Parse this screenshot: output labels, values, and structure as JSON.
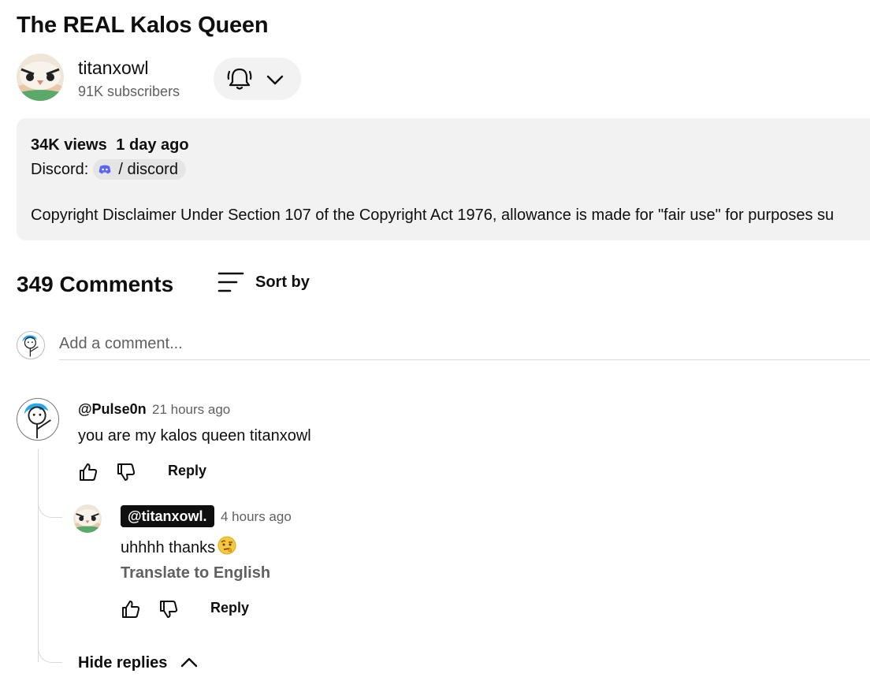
{
  "video": {
    "title": "The REAL Kalos Queen"
  },
  "channel": {
    "name": "titanxowl",
    "subscribers": "91K subscribers"
  },
  "notifications": {
    "bell_icon": "bell-icon",
    "chevron_icon": "chevron-down-icon"
  },
  "description": {
    "views": "34K views",
    "age": "1 day ago",
    "discord_label": "Discord:",
    "discord_link": "/ discord",
    "copyright": "Copyright Disclaimer Under Section 107 of the Copyright Act 1976, allowance is made for \"fair use\" for purposes su"
  },
  "comments": {
    "count_label": "349 Comments",
    "sort_label": "Sort by",
    "add_placeholder": "Add a comment..."
  },
  "comment": {
    "author": "@Pulse0n",
    "time": "21 hours ago",
    "text": "you are my kalos queen titanxowl",
    "reply_label": "Reply"
  },
  "reply": {
    "author": "@titanxowl.",
    "time": "4 hours ago",
    "text": "uhhhh thanks",
    "emoji": "🤨",
    "translate_label": "Translate to English",
    "reply_label": "Reply"
  },
  "hide_replies_label": "Hide replies",
  "colors": {
    "background": "#ffffff",
    "panel": "#f2f2f2",
    "text": "#0f0f0f",
    "muted": "#606060",
    "discord": "#5865f2"
  }
}
